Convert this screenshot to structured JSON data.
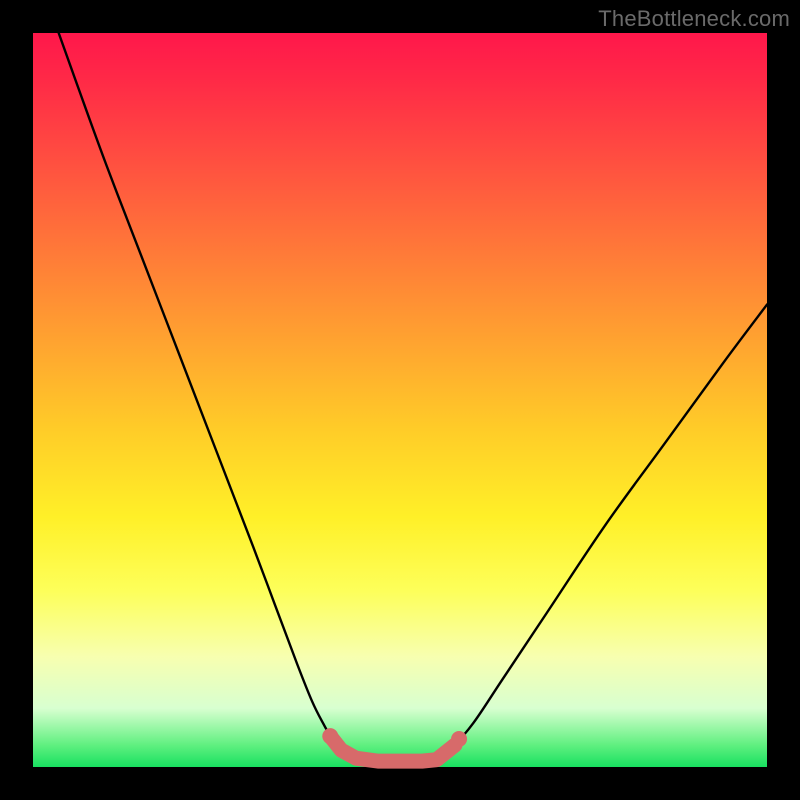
{
  "watermark": "TheBottleneck.com",
  "colors": {
    "page_bg": "#000000",
    "gradient_top": "#ff174b",
    "gradient_bottom": "#18e060",
    "curve_stroke": "#000000",
    "marker_stroke": "#d76a6a",
    "marker_fill": "#d76a6a"
  },
  "chart_data": {
    "type": "line",
    "title": "",
    "xlabel": "",
    "ylabel": "",
    "xlim": [
      0,
      100
    ],
    "ylim": [
      0,
      100
    ],
    "grid": false,
    "series": [
      {
        "name": "left-branch",
        "x": [
          3.5,
          6,
          10,
          15,
          20,
          25,
          30,
          33,
          36,
          38,
          39.5,
          41,
          43,
          45
        ],
        "y": [
          100,
          93,
          82,
          69,
          56,
          43,
          30,
          22,
          14,
          9,
          6,
          3.5,
          1.5,
          0.8
        ]
      },
      {
        "name": "right-branch",
        "x": [
          55,
          57,
          60,
          64,
          70,
          78,
          86,
          94,
          100
        ],
        "y": [
          0.8,
          2.5,
          6,
          12,
          21,
          33,
          44,
          55,
          63
        ]
      }
    ],
    "flat_bottom": {
      "x_start": 45,
      "x_end": 55,
      "y": 0.8
    },
    "markers": {
      "name": "salmon-segment",
      "points": [
        {
          "x": 40.5,
          "y": 4.2
        },
        {
          "x": 42,
          "y": 2.3
        },
        {
          "x": 44,
          "y": 1.2
        },
        {
          "x": 47,
          "y": 0.8
        },
        {
          "x": 50,
          "y": 0.8
        },
        {
          "x": 53,
          "y": 0.8
        },
        {
          "x": 55,
          "y": 1.0
        },
        {
          "x": 57.5,
          "y": 3.0
        }
      ]
    }
  }
}
